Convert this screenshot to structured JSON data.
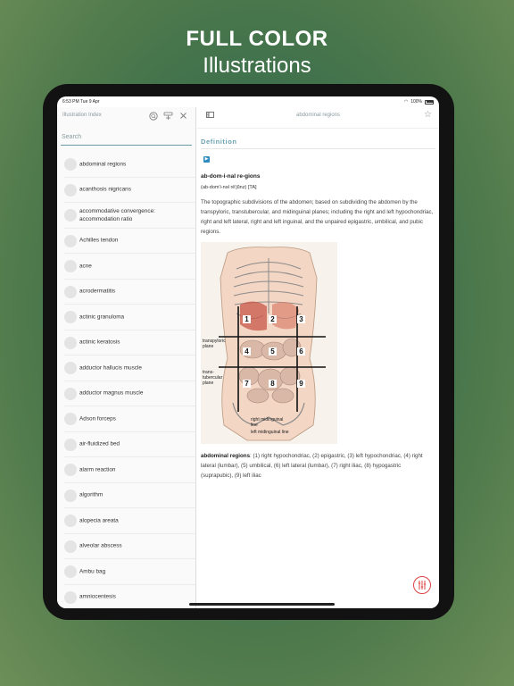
{
  "hero": {
    "line1": "FULL COLOR",
    "line2": "Illustrations"
  },
  "statusbar": {
    "time": "6:53 PM   Tue 9 Apr",
    "battery": "100%"
  },
  "sidebar": {
    "title": "Illustration Index",
    "search_placeholder": "Search",
    "items": [
      {
        "label": "abdominal regions"
      },
      {
        "label": "acanthosis nigricans"
      },
      {
        "label": "accommodative convergence: accommodation ratio"
      },
      {
        "label": "Achilles tendon"
      },
      {
        "label": "acne"
      },
      {
        "label": "acrodermatitis"
      },
      {
        "label": "actinic granuloma"
      },
      {
        "label": "actinic keratosis"
      },
      {
        "label": "adductor hallucis muscle"
      },
      {
        "label": "adductor magnus muscle"
      },
      {
        "label": "Adson forceps"
      },
      {
        "label": "air-fluidized bed"
      },
      {
        "label": "alarm reaction"
      },
      {
        "label": "algorithm"
      },
      {
        "label": "alopecia areata"
      },
      {
        "label": "alveolar abscess"
      },
      {
        "label": "Ambu bag"
      },
      {
        "label": "amniocentesis"
      }
    ]
  },
  "content": {
    "title": "abdominal regions",
    "section": "Definition",
    "term": "ab-dom-i-nal re-gions",
    "pronunciation": "(ab-dom'i-nəl rē'jŭnz) [TA]",
    "definition": "The topographic subdivisions of the abdomen; based on subdividing the abdomen by the transpyloric, transtubercular, and midinguinal planes; including the right and left hypochondriac, right and left lateral, right and left inguinal, and the unpaired epigastric, umbilical, and pubic regions.",
    "caption_term": "abdominal regions",
    "caption_text": ": (1) right hypochondriac, (2) epigastric, (3) left hypochondriac, (4) right lateral (lumbar), (5) umbilical, (6) left lateral (lumbar), (7) right iliac, (8) hypogastric (suprapubic), (9) left iliac",
    "figure": {
      "region_numbers": [
        "1",
        "2",
        "3",
        "4",
        "5",
        "6",
        "7",
        "8",
        "9"
      ],
      "label_transpyloric": "transpyloric plane",
      "label_transtubercular": "trans-tubercular plane",
      "label_right_midinguinal": "right midinguinal line",
      "label_left_midinguinal": "left midinguinal line"
    }
  },
  "colors": {
    "accent": "#6aa3b3",
    "fab": "#dd4444"
  }
}
